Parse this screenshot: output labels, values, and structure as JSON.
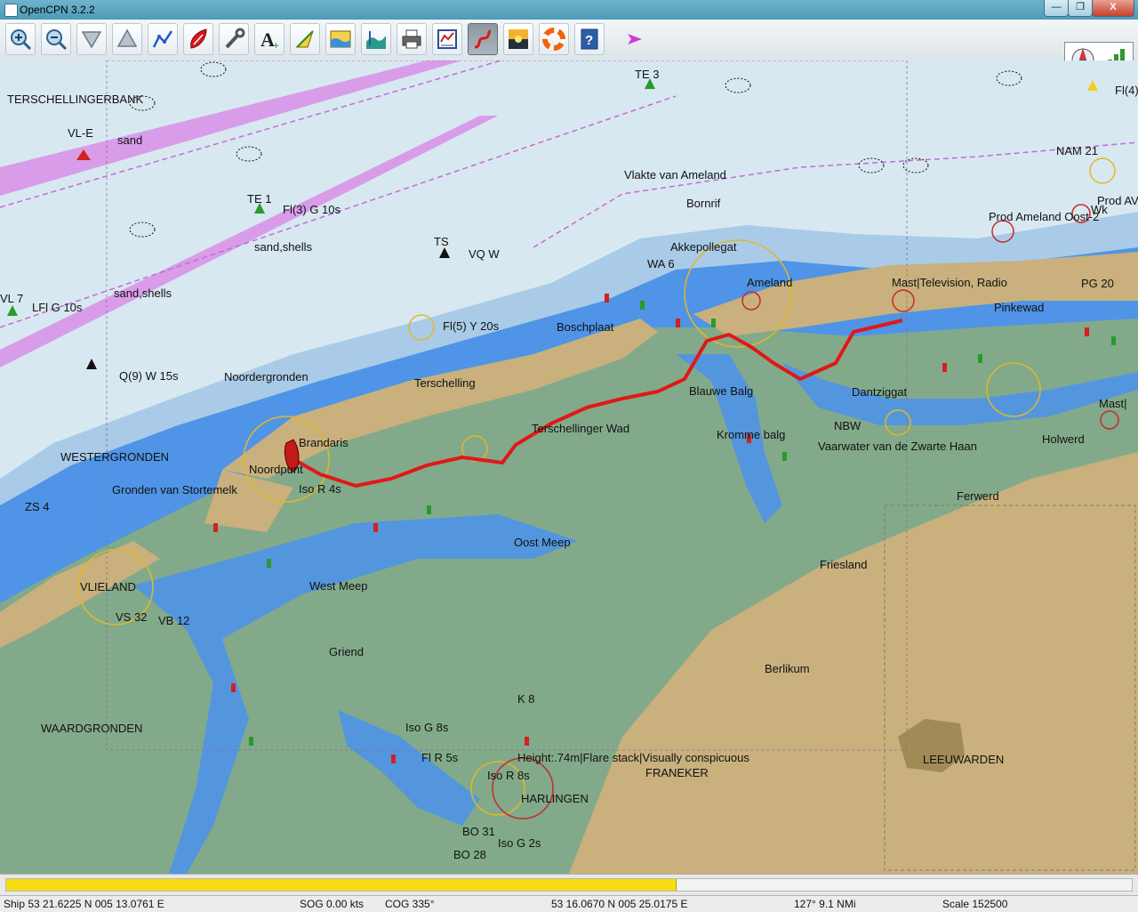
{
  "window": {
    "title": "OpenCPN 3.2.2",
    "minimize": "—",
    "maximize": "❐",
    "close": "X"
  },
  "toolbar": {
    "tools": [
      {
        "name": "zoom-in-button",
        "icon": "zoom-in-icon"
      },
      {
        "name": "zoom-out-button",
        "icon": "zoom-out-icon"
      },
      {
        "name": "scale-in-button",
        "icon": "scale-in-icon"
      },
      {
        "name": "scale-out-button",
        "icon": "scale-out-icon"
      },
      {
        "name": "create-route-button",
        "icon": "route-icon"
      },
      {
        "name": "auto-follow-button",
        "icon": "ship-icon"
      },
      {
        "name": "settings-button",
        "icon": "wrench-icon"
      },
      {
        "name": "text-button",
        "icon": "text-icon"
      },
      {
        "name": "current-tide-button",
        "icon": "current-icon"
      },
      {
        "name": "tide-button",
        "icon": "tide-icon"
      },
      {
        "name": "tide-table-button",
        "icon": "tide-table-icon"
      },
      {
        "name": "print-button",
        "icon": "print-icon"
      },
      {
        "name": "route-manager-button",
        "icon": "route-manager-icon"
      },
      {
        "name": "track-button",
        "icon": "track-icon"
      },
      {
        "name": "color-scheme-button",
        "icon": "color-scheme-icon"
      },
      {
        "name": "mob-button",
        "icon": "lifebuoy-icon"
      },
      {
        "name": "help-button",
        "icon": "help-icon"
      }
    ],
    "track_button_active": true
  },
  "chart_labels": [
    {
      "text": "TERSCHELLINGERBANK"
    },
    {
      "text": "VL-E"
    },
    {
      "text": "sand"
    },
    {
      "text": "TE 1"
    },
    {
      "text": "Fl(3) G 10s"
    },
    {
      "text": "sand,shells"
    },
    {
      "text": "TS"
    },
    {
      "text": "VQ W"
    },
    {
      "text": "WA 6"
    },
    {
      "text": "Vlakte van Ameland"
    },
    {
      "text": "Bornrif"
    },
    {
      "text": "Akkepollegat"
    },
    {
      "text": "Ameland"
    },
    {
      "text": "Mast|Television, Radio"
    },
    {
      "text": "Prod Ameland Oost-2"
    },
    {
      "text": "NAM 21"
    },
    {
      "text": "Fl(4)"
    },
    {
      "text": "Prod AV"
    },
    {
      "text": "TE 3"
    },
    {
      "text": "Wk"
    },
    {
      "text": "LFl G 10s"
    },
    {
      "text": "VL 7"
    },
    {
      "text": "Q(9) W 15s"
    },
    {
      "text": "Noordergronden"
    },
    {
      "text": "Terschelling"
    },
    {
      "text": "Boschplaat"
    },
    {
      "text": "Fl(5) Y 20s"
    },
    {
      "text": "Terschellinger Wad"
    },
    {
      "text": "Blauwe Balg"
    },
    {
      "text": "Kromme balg"
    },
    {
      "text": "Vaarwater van de Zwarte Haan"
    },
    {
      "text": "Holwerd"
    },
    {
      "text": "Ferwerd"
    },
    {
      "text": "Pinkewad"
    },
    {
      "text": "Dantziggat"
    },
    {
      "text": "NBW"
    },
    {
      "text": "Friesland"
    },
    {
      "text": "Berlikum"
    },
    {
      "text": "LEEUWARDEN"
    },
    {
      "text": "FRANEKER"
    },
    {
      "text": "HARLINGEN"
    },
    {
      "text": "Height:.74m|Flare stack|Visually conspicuous"
    },
    {
      "text": "WESTERGRONDEN"
    },
    {
      "text": "Gronden van Stortemelk"
    },
    {
      "text": "VLIELAND"
    },
    {
      "text": "WAARDGRONDEN"
    },
    {
      "text": "Griend"
    },
    {
      "text": "West Meep"
    },
    {
      "text": "Oost Meep"
    },
    {
      "text": "Brandaris"
    },
    {
      "text": "Noordpunt"
    },
    {
      "text": "Iso R 4s"
    },
    {
      "text": "Iso G 8s"
    },
    {
      "text": "Iso R 8s"
    },
    {
      "text": "Iso G 2s"
    },
    {
      "text": "Fl R 5s"
    },
    {
      "text": "VS 32"
    },
    {
      "text": "VB 12"
    },
    {
      "text": "ZS 4"
    },
    {
      "text": "BO 31"
    },
    {
      "text": "BO 28"
    },
    {
      "text": "K 8"
    },
    {
      "text": "PG 20"
    },
    {
      "text": "Mast|"
    },
    {
      "text": "sand,shells"
    }
  ],
  "progress": {
    "fraction": 0.595
  },
  "status": {
    "ship": "Ship 53 21.6225 N   005 13.0761 E",
    "sog": "SOG 0.00 kts",
    "cog": "COG 335°",
    "cursor": "53 16.0670 N   005 25.0175 E",
    "bearing": "127°  9.1 NMi",
    "scale": "Scale 152500"
  },
  "colors": {
    "deep_water": "#d8e8f0",
    "medium_water": "#a9cbe7",
    "shallow_water": "#4f94e6",
    "drying": "#82aa8a",
    "land": "#c9b07d",
    "route": "#e01818",
    "traffic_lane": "#d88ee8"
  }
}
